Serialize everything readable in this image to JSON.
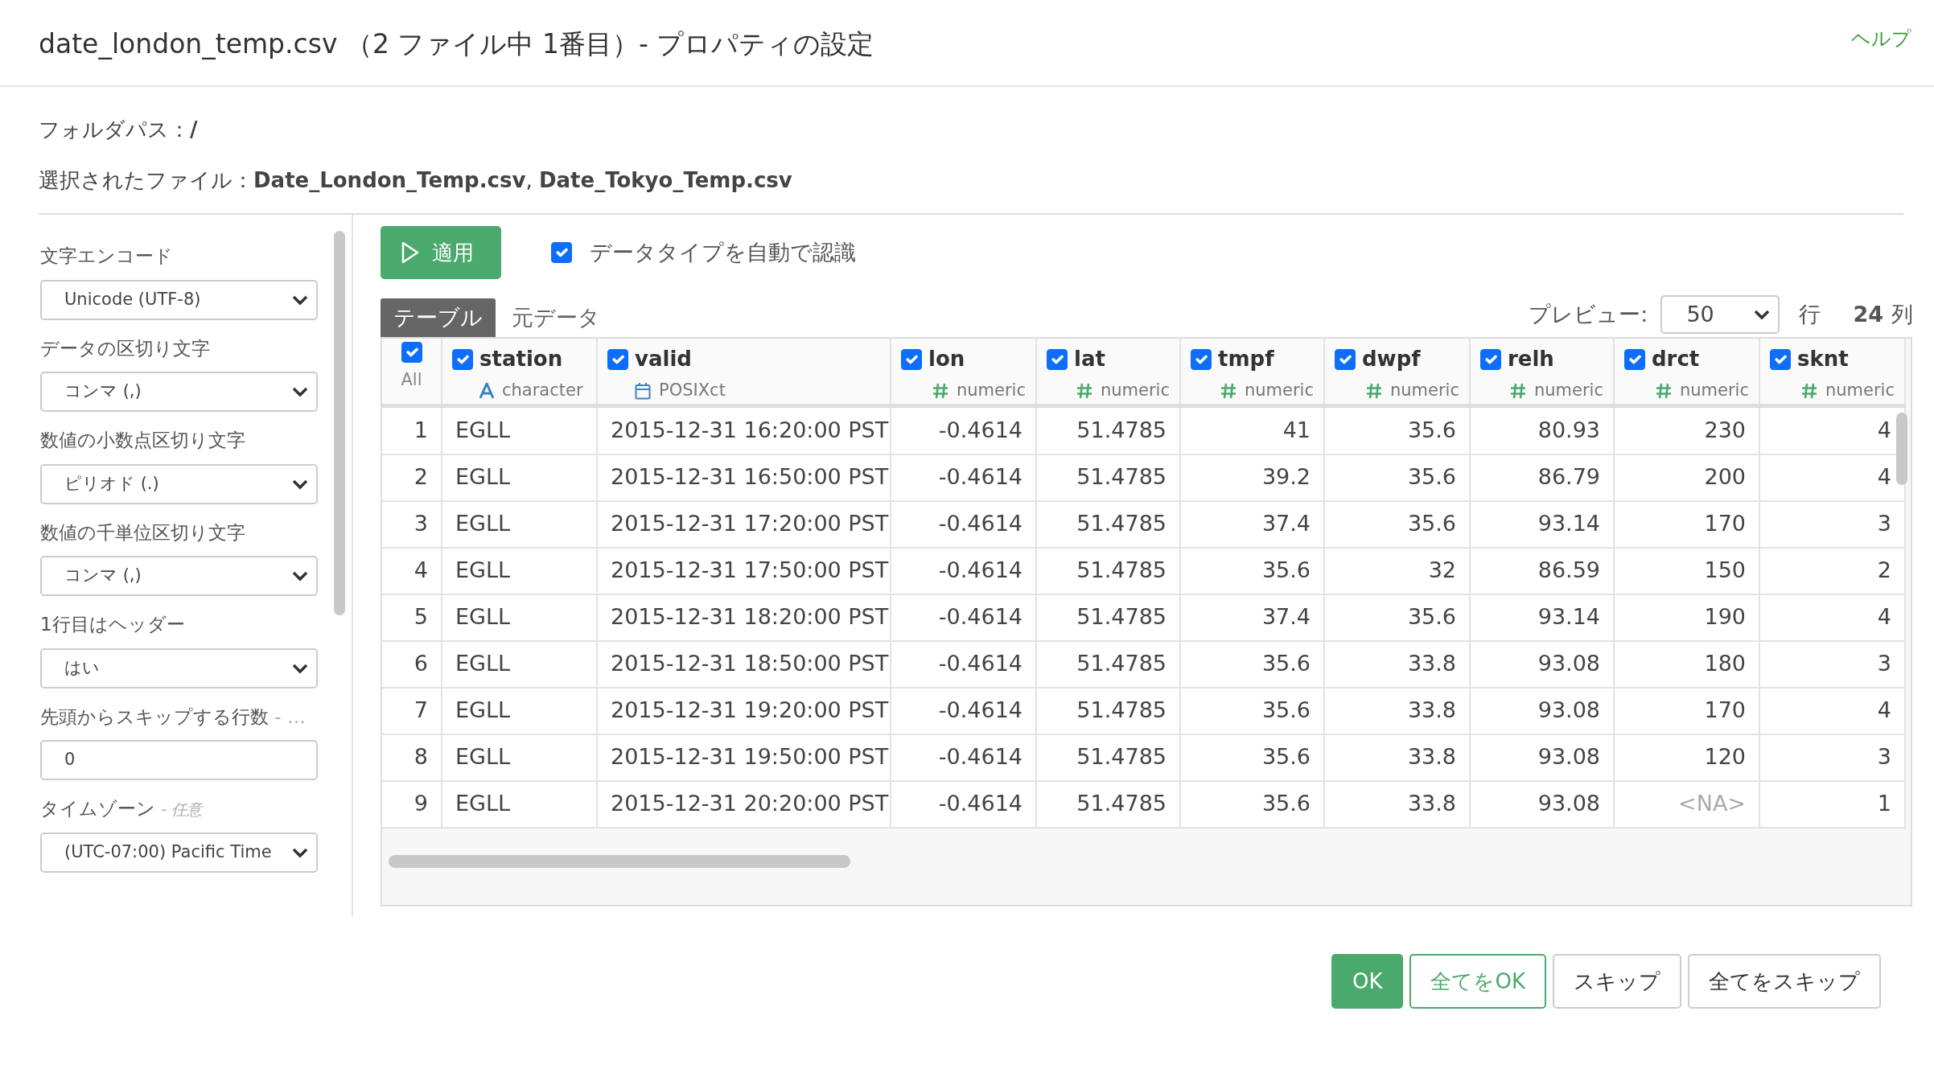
{
  "dialog": {
    "title": "date_london_temp.csv （2 ファイル中 1番目）- プロパティの設定",
    "help_link": "ヘルプ"
  },
  "folder_path": "フォルダパス：**/**",
  "selected_files": "選択されたファイル：**Date_London_Temp.csv**, **Date_Tokyo_Temp.csv**",
  "settings": [
    {
      "kind": "select",
      "label": "文字エンコード",
      "value": "Unicode (UTF-8)"
    },
    {
      "kind": "select",
      "label": "データの区切り文字",
      "value": "コンマ (,)"
    },
    {
      "kind": "select",
      "label": "数値の小数点区切り文字",
      "value": "ピリオド (.)"
    },
    {
      "kind": "select",
      "label": "数値の千単位区切り文字",
      "value": "コンマ (,)"
    },
    {
      "kind": "select",
      "label": "1行目はヘッダー",
      "value": "はい"
    },
    {
      "kind": "input",
      "label": "先頭からスキップする行数",
      "note": "- …",
      "value": "0"
    },
    {
      "kind": "select",
      "label": "タイムゾーン",
      "note": "- 任意",
      "value": "(UTC-07:00) Pacific Time"
    }
  ],
  "apply_button": "適用",
  "auto_detect": {
    "label": "データタイプを自動で認識",
    "checked": true
  },
  "tabs": [
    {
      "label": "テーブル",
      "selected": true
    },
    {
      "label": "元データ",
      "selected": false
    }
  ],
  "preview": {
    "label": "プレビュー:",
    "value": "50",
    "rows_label": "行",
    "column_count": "24",
    "columns_label": "列"
  },
  "table": {
    "columns": [
      {
        "name": "All",
        "kind": "all",
        "checked": true
      },
      {
        "name": "station",
        "type": "character",
        "kind": "character",
        "checked": true
      },
      {
        "name": "valid",
        "type": "POSIXct",
        "kind": "date",
        "checked": true
      },
      {
        "name": "lon",
        "type": "numeric",
        "kind": "numeric",
        "checked": true
      },
      {
        "name": "lat",
        "type": "numeric",
        "kind": "numeric",
        "checked": true
      },
      {
        "name": "tmpf",
        "type": "numeric",
        "kind": "numeric",
        "checked": true
      },
      {
        "name": "dwpf",
        "type": "numeric",
        "kind": "numeric",
        "checked": true
      },
      {
        "name": "relh",
        "type": "numeric",
        "kind": "numeric",
        "checked": true
      },
      {
        "name": "drct",
        "type": "numeric",
        "kind": "numeric",
        "checked": true
      },
      {
        "name": "sknt",
        "type": "numeric",
        "kind": "numeric",
        "checked": true
      }
    ],
    "rows": [
      [
        "1",
        "EGLL",
        "2015-12-31 16:20:00 PST",
        "-0.4614",
        "51.4785",
        "41",
        "35.6",
        "80.93",
        "230",
        "4"
      ],
      [
        "2",
        "EGLL",
        "2015-12-31 16:50:00 PST",
        "-0.4614",
        "51.4785",
        "39.2",
        "35.6",
        "86.79",
        "200",
        "4"
      ],
      [
        "3",
        "EGLL",
        "2015-12-31 17:20:00 PST",
        "-0.4614",
        "51.4785",
        "37.4",
        "35.6",
        "93.14",
        "170",
        "3"
      ],
      [
        "4",
        "EGLL",
        "2015-12-31 17:50:00 PST",
        "-0.4614",
        "51.4785",
        "35.6",
        "32",
        "86.59",
        "150",
        "2"
      ],
      [
        "5",
        "EGLL",
        "2015-12-31 18:20:00 PST",
        "-0.4614",
        "51.4785",
        "37.4",
        "35.6",
        "93.14",
        "190",
        "4"
      ],
      [
        "6",
        "EGLL",
        "2015-12-31 18:50:00 PST",
        "-0.4614",
        "51.4785",
        "35.6",
        "33.8",
        "93.08",
        "180",
        "3"
      ],
      [
        "7",
        "EGLL",
        "2015-12-31 19:20:00 PST",
        "-0.4614",
        "51.4785",
        "35.6",
        "33.8",
        "93.08",
        "170",
        "4"
      ],
      [
        "8",
        "EGLL",
        "2015-12-31 19:50:00 PST",
        "-0.4614",
        "51.4785",
        "35.6",
        "33.8",
        "93.08",
        "120",
        "3"
      ],
      [
        "9",
        "EGLL",
        "2015-12-31 20:20:00 PST",
        "-0.4614",
        "51.4785",
        "35.6",
        "33.8",
        "93.08",
        {
          "text": "<NA>",
          "missing": true
        },
        "1"
      ]
    ]
  },
  "buttons": [
    {
      "label": "OK",
      "kind": "primary"
    },
    {
      "label": "全てをOK",
      "kind": "outline"
    },
    {
      "label": "スキップ",
      "kind": "default"
    },
    {
      "label": "全てをスキップ",
      "kind": "default"
    }
  ]
}
